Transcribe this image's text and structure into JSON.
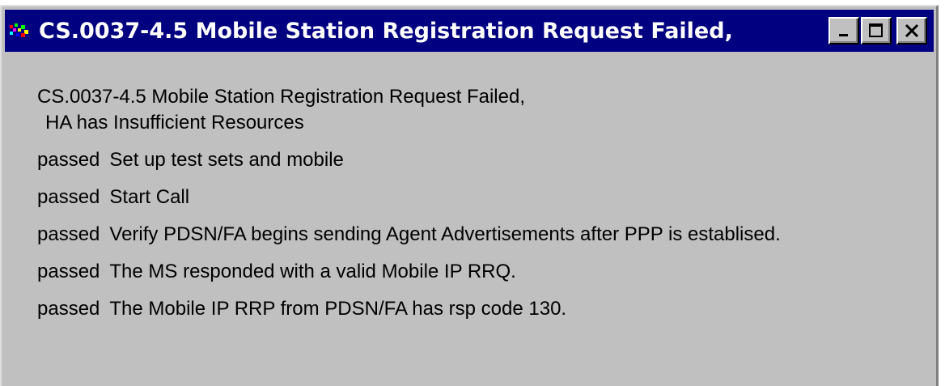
{
  "window": {
    "title": "CS.0037-4.5 Mobile Station Registration Request Failed,",
    "controls": {
      "minimize_icon": "minimize-icon",
      "maximize_icon": "maximize-icon",
      "close_icon": "close-icon"
    },
    "colors": {
      "titlebar": "#000080",
      "face": "#c0c0c0",
      "title_text": "#ffffff"
    }
  },
  "report": {
    "header_line1": "CS.0037-4.5 Mobile Station Registration Request Failed,",
    "header_line2": "HA has Insufficient Resources",
    "steps": [
      {
        "status": "passed",
        "text": "Set up test sets and mobile"
      },
      {
        "status": "passed",
        "text": "Start Call"
      },
      {
        "status": "passed",
        "text": "Verify PDSN/FA begins sending Agent Advertisements after PPP is establised."
      },
      {
        "status": "passed",
        "text": "The MS responded with a valid Mobile IP  RRQ."
      },
      {
        "status": "passed",
        "text": "The Mobile IP RRP from PDSN/FA has rsp code 130."
      }
    ]
  }
}
